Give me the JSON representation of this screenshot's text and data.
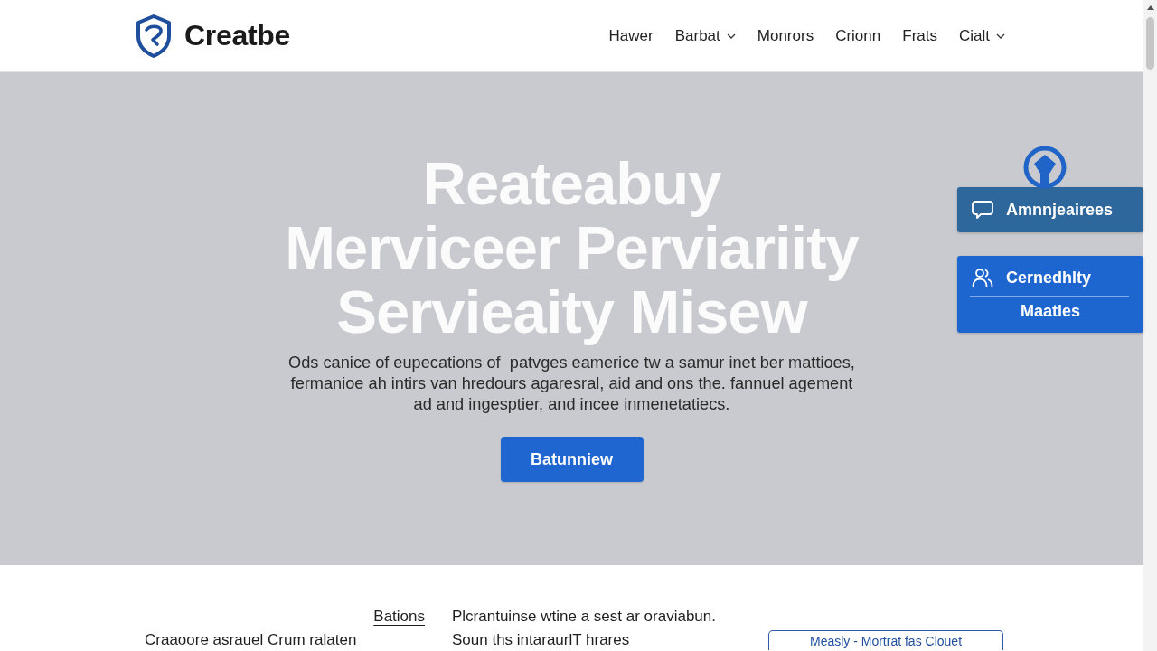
{
  "header": {
    "brand": "Creatbe",
    "nav": [
      {
        "label": "Hawer",
        "dropdown": false
      },
      {
        "label": "Barbat",
        "dropdown": true
      },
      {
        "label": "Monrors",
        "dropdown": false
      },
      {
        "label": "Crionn",
        "dropdown": false
      },
      {
        "label": "Frats",
        "dropdown": false
      },
      {
        "label": "Cialt",
        "dropdown": true
      }
    ]
  },
  "hero": {
    "title_lines": [
      "Reateabuy",
      "Merviceer Perviariity",
      "Servieaity Misew"
    ],
    "text_lines": [
      "Ods canice of eupecations of  patvges eamerice tw a samur inet ber mattioes,",
      "fermanioe ah intirs van hredours agaresral, aid and ons the. fannuel agement",
      "ad and ingesptier, and incee inmenetatiecs."
    ],
    "button": "Batunniew"
  },
  "side_panel": {
    "cards": [
      {
        "kind": "chat",
        "label": "Amnnjeairees"
      },
      {
        "kind": "people",
        "label": "Cernedhlty",
        "sublabel": "Maaties"
      }
    ]
  },
  "lower": {
    "link": "Bations",
    "left_text": "Craaoore asrauel Crum ralaten",
    "lines": [
      "Plcrantuinse wtine a sest ar oraviabun.",
      "Soun ths intaraurlT hrares"
    ],
    "button": "Measly - Mortrat fas Clouet"
  }
}
